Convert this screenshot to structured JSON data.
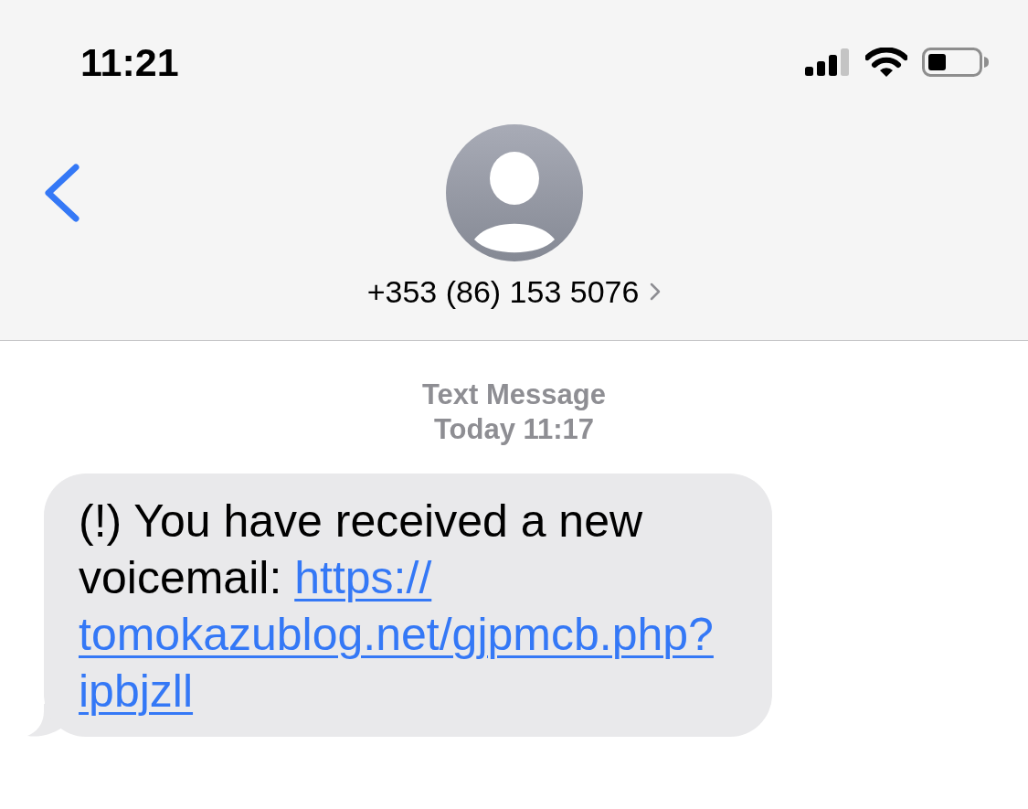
{
  "status_bar": {
    "time": "11:21"
  },
  "contact": {
    "phone": "+353 (86) 153 5076"
  },
  "conversation": {
    "service": "Text Message",
    "timestamp": "Today 11:17"
  },
  "messages": [
    {
      "kind": "received",
      "text": "(!) You have received a new voicemail:",
      "link_lines": [
        "https://",
        "tomokazublog.net/gjpmcb.php?",
        "ipbjzll"
      ]
    }
  ]
}
